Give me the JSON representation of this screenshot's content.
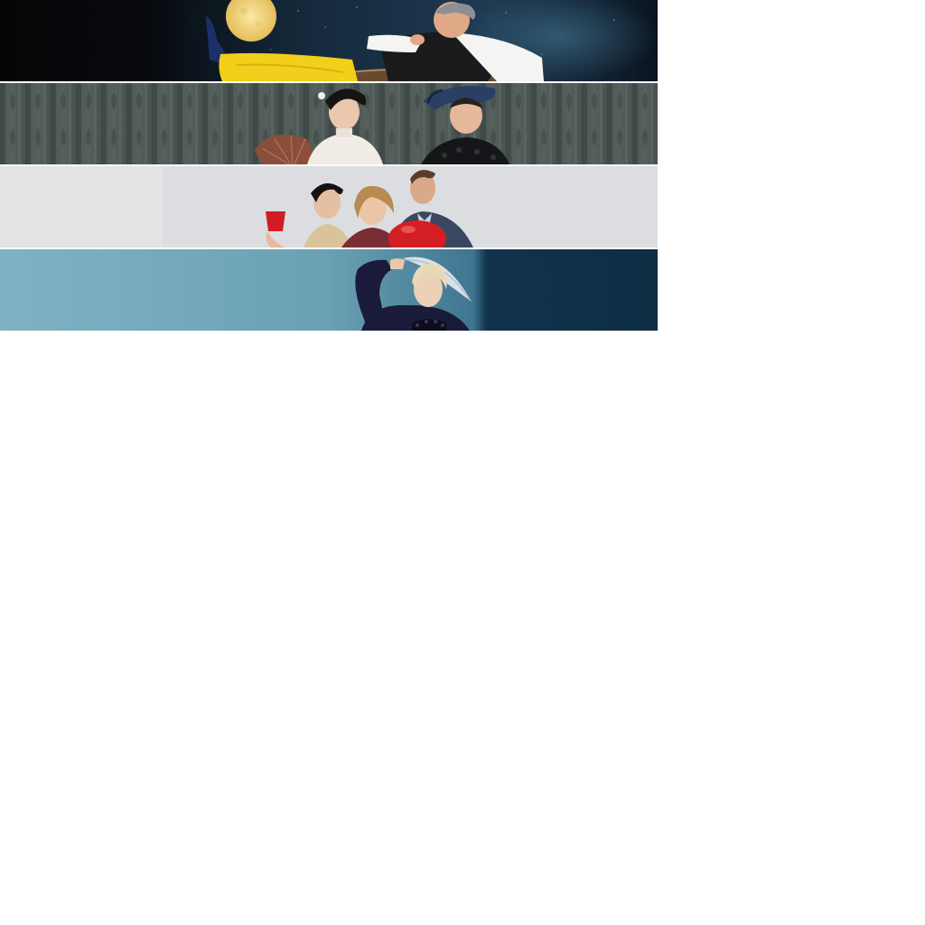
{
  "banners": [
    {
      "id": "night-lounge",
      "colors": {
        "sky_dark": "#050608",
        "sky_blue": "#1e3a52",
        "moon": "#f2d27a",
        "yellow_trousers": "#f1cf1a",
        "waistcoat": "#1b1b1e",
        "shirt": "#f4f4f2",
        "shoe": "#1c2f6b"
      }
    },
    {
      "id": "damask-curtain",
      "colors": {
        "curtain": "#4a5552",
        "curtain_fold": "#36403e",
        "fan": "#8a4e3a",
        "blouse_white": "#f1ede6",
        "hat_blue": "#2a3f66",
        "lace_black": "#151618"
      }
    },
    {
      "id": "grey-party",
      "colors": {
        "backdrop": "#dcdde0",
        "red_cup": "#d11d22",
        "red_balloon": "#d31f24",
        "shirt_navy": "#3a4760",
        "dress_gold": "#d8c39a"
      }
    },
    {
      "id": "teal-feather",
      "colors": {
        "wall_light": "#7fb2c3",
        "wall_dark": "#0e2d44",
        "gown": "#1a1b3a",
        "hair": "#e9d9b6",
        "feather": "#d7e1e8"
      }
    }
  ]
}
